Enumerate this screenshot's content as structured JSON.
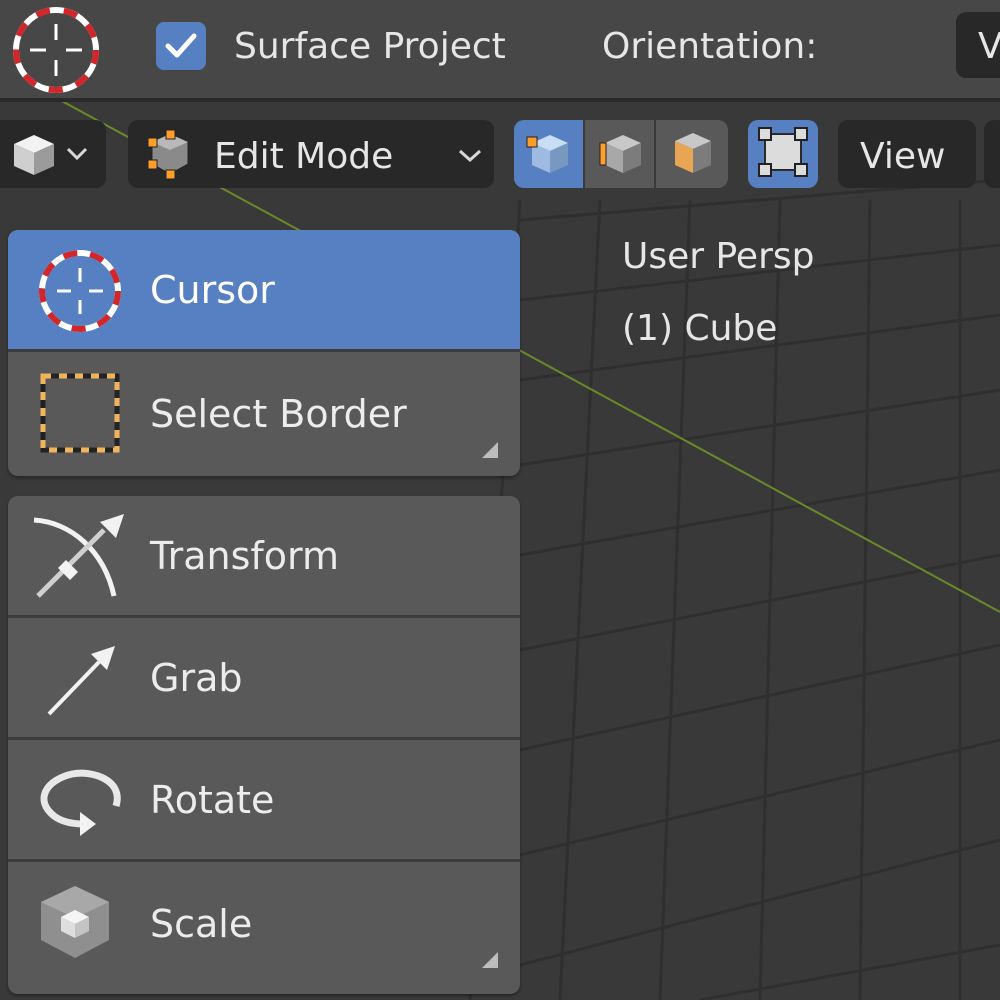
{
  "tool_header": {
    "active_tool_icon": "cursor-icon",
    "surface_project_checked": true,
    "surface_project_label": "Surface Project",
    "orientation_label": "Orientation:",
    "orientation_value": "V"
  },
  "view_header": {
    "object_type_icon": "cube-icon",
    "mode_label": "Edit Mode",
    "select_modes": [
      {
        "icon": "vertex-select-icon",
        "active": true
      },
      {
        "icon": "edge-select-icon",
        "active": false
      },
      {
        "icon": "face-select-icon",
        "active": false
      }
    ],
    "proportional_icon": "proportional-editing-icon",
    "view_menu_label": "View"
  },
  "overlay": {
    "view_name": "User Persp",
    "object_name": "(1) Cube"
  },
  "toolbar": {
    "group1": [
      {
        "label": "Cursor",
        "icon": "cursor-icon",
        "active": true
      },
      {
        "label": "Select Border",
        "icon": "select-border-icon",
        "active": false
      }
    ],
    "group2": [
      {
        "label": "Transform",
        "icon": "transform-icon",
        "active": false
      },
      {
        "label": "Grab",
        "icon": "grab-icon",
        "active": false
      },
      {
        "label": "Rotate",
        "icon": "rotate-icon",
        "active": false
      },
      {
        "label": "Scale",
        "icon": "scale-icon",
        "active": false
      }
    ]
  },
  "colors": {
    "accent": "#5680c2",
    "header_bg": "#474747",
    "widget_bg": "#282828",
    "tool_bg": "#595959",
    "viewport_bg": "#393939",
    "grid_line": "#2f2f2f",
    "axis_green": "#6a8a2a"
  }
}
